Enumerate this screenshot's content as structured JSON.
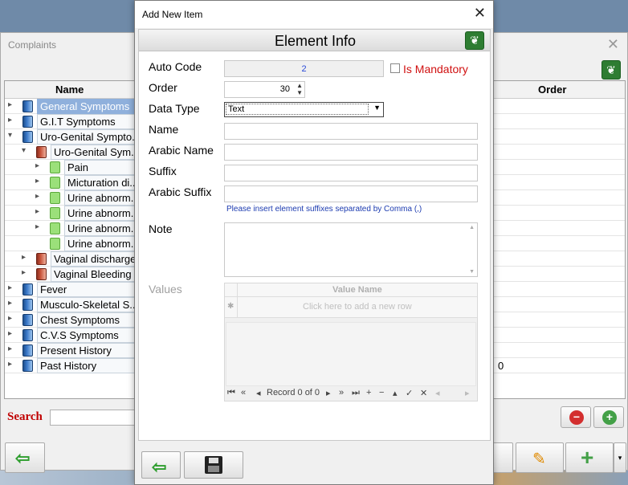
{
  "background": {
    "window_title": "Complaints",
    "close_glyph": "✕",
    "columns": {
      "name": "Name",
      "order": "Order"
    },
    "rows": [
      {
        "label": "General Symptoms",
        "order": "",
        "expander": "▸",
        "book": "blue",
        "selected": true
      },
      {
        "label": "G.I.T Symptoms",
        "order": "",
        "expander": "▸",
        "book": "blue"
      },
      {
        "label": "Uro-Genital Sympto...",
        "order": "",
        "expander": "▾",
        "book": "blue"
      },
      {
        "label": "Uro-Genital Sym...",
        "order": "",
        "expander": "▾",
        "book": "red"
      },
      {
        "label": "Pain",
        "order": "",
        "expander": "▸",
        "book": "green"
      },
      {
        "label": "Micturation di...",
        "order": "",
        "expander": "▸",
        "book": "green"
      },
      {
        "label": "Urine abnorm...",
        "order": "",
        "expander": "▸",
        "book": "green"
      },
      {
        "label": "Urine abnorm...",
        "order": "",
        "expander": "▸",
        "book": "green"
      },
      {
        "label": "Urine abnorm...",
        "order": "",
        "expander": "▸",
        "book": "green"
      },
      {
        "label": "Urine abnorm...",
        "order": "",
        "expander": "",
        "book": "green"
      },
      {
        "label": "Vaginal discharge",
        "order": "",
        "expander": "▸",
        "book": "red"
      },
      {
        "label": "Vaginal Bleeding",
        "order": "",
        "expander": "▸",
        "book": "red"
      },
      {
        "label": "Fever",
        "order": "",
        "expander": "▸",
        "book": "blue"
      },
      {
        "label": "Musculo-Skeletal S...",
        "order": "",
        "expander": "▸",
        "book": "blue"
      },
      {
        "label": "Chest Symptoms",
        "order": "",
        "expander": "▸",
        "book": "blue"
      },
      {
        "label": "C.V.S Symptoms",
        "order": "",
        "expander": "▸",
        "book": "blue"
      },
      {
        "label": "Present History",
        "order": "",
        "expander": "▸",
        "book": "blue"
      },
      {
        "label": "Past History",
        "order": "0",
        "expander": "▸",
        "book": "blue"
      }
    ],
    "search_label": "Search",
    "search_value": ""
  },
  "dialog": {
    "title": "Add New Item",
    "close_glyph": "✕",
    "header": "Element Info",
    "auto_code_label": "Auto Code",
    "auto_code_value": "2",
    "is_mandatory_label": "Is Mandatory",
    "is_mandatory_checked": false,
    "order_label": "Order",
    "order_value": "30",
    "data_type_label": "Data Type",
    "data_type_value": "Text",
    "name_label": "Name",
    "name_value": "",
    "arabic_name_label": "Arabic Name",
    "arabic_name_value": "",
    "suffix_label": "Suffix",
    "suffix_value": "",
    "arabic_suffix_label": "Arabic Suffix",
    "arabic_suffix_value": "",
    "suffix_hint": "Please insert element suffixes separated by Comma (,)",
    "note_label": "Note",
    "note_value": "",
    "values_label": "Values",
    "values_grid": {
      "column": "Value Name",
      "new_row_marker": "✱",
      "new_row_text": "Click here to add a new row",
      "navigator": {
        "first": "⏮",
        "prev_page": "«",
        "prev": "◂",
        "record_text": "Record 0 of 0",
        "next": "▸",
        "next_page": "»",
        "last": "⏭",
        "append": "+",
        "remove": "−",
        "up": "▴",
        "ok": "✓",
        "cancel": "✕",
        "left": "◂",
        "right": "▸"
      }
    }
  },
  "colors": {
    "mandatory": "#d01010",
    "hint": "#1c3bb0",
    "search": "#c00000",
    "selected_row": "#8fb0dc"
  },
  "icons": {
    "back": "arrow-left-icon",
    "save": "floppy-disk-icon",
    "leaf": "leaf-icon",
    "edit": "pencil-icon",
    "add": "plus-icon",
    "remove": "minus-circle-icon"
  }
}
